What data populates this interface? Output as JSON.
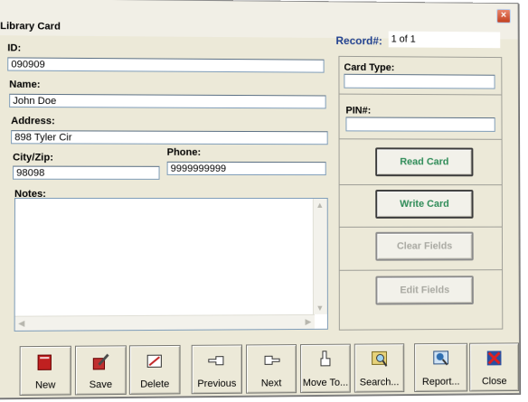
{
  "window": {
    "title": "Library Card",
    "close_glyph": "×"
  },
  "form": {
    "id_label": "ID:",
    "id_value": "090909",
    "name_label": "Name:",
    "name_value": "John Doe",
    "address_label": "Address:",
    "address_value": "898 Tyler Cir",
    "cityzip_label": "City/Zip:",
    "cityzip_value": "98098",
    "phone_label": "Phone:",
    "phone_value": "9999999999",
    "notes_label": "Notes:",
    "notes_value": ""
  },
  "record": {
    "label": "Record#:",
    "value": "1 of 1"
  },
  "card": {
    "type_label": "Card Type:",
    "type_value": "",
    "pin_label": "PIN#:",
    "pin_value": ""
  },
  "card_buttons": {
    "read": "Read Card",
    "write": "Write Card",
    "clear": "Clear Fields",
    "edit": "Edit Fields"
  },
  "toolbar": {
    "new": "New",
    "save": "Save",
    "delete": "Delete",
    "previous": "Previous",
    "next": "Next",
    "move_to": "Move To...",
    "search": "Search...",
    "report": "Report...",
    "close": "Close"
  },
  "colors": {
    "accent_green": "#2e8b57",
    "record_blue": "#1f3f8f",
    "disabled": "#a9a9a2"
  }
}
